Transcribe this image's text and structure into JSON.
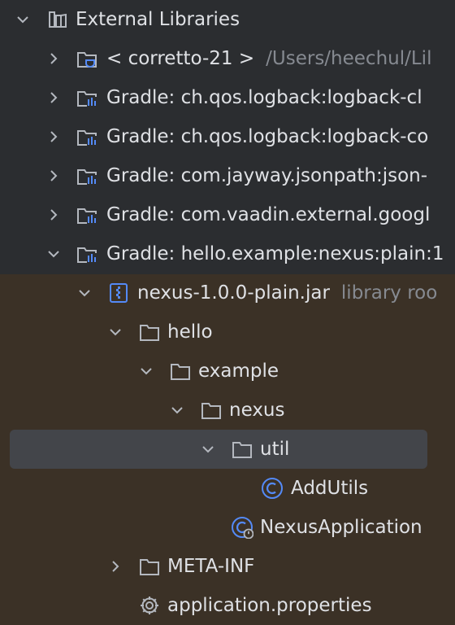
{
  "tree": {
    "external_libraries": "External Libraries",
    "jdk": {
      "label": "< corretto-21 >",
      "path": "/Users/heechul/Lil"
    },
    "lib1": "Gradle: ch.qos.logback:logback-cl",
    "lib2": "Gradle: ch.qos.logback:logback-co",
    "lib3": "Gradle: com.jayway.jsonpath:json-",
    "lib4": "Gradle: com.vaadin.external.googl",
    "lib5": "Gradle: hello.example:nexus:plain:1",
    "jar": {
      "label": "nexus-1.0.0-plain.jar",
      "hint": "library roo"
    },
    "pkg_hello": "hello",
    "pkg_example": "example",
    "pkg_nexus": "nexus",
    "pkg_util": "util",
    "class_addutils": "AddUtils",
    "class_nexusapp": "NexusApplication",
    "folder_meta": "META-INF",
    "file_props": "application.properties"
  },
  "colors": {
    "background": "#2b2d30",
    "library_scope_background": "#3b3126",
    "selection": "#43454a",
    "text": "#dfe1e5",
    "hint_text": "#868a91",
    "class_icon": "#548af7"
  }
}
